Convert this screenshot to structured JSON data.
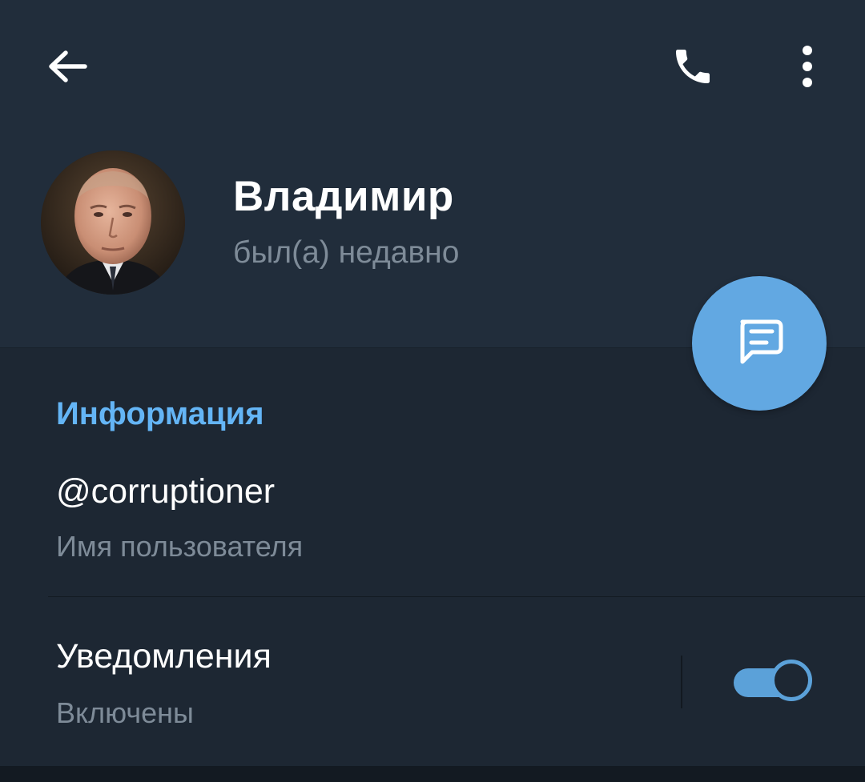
{
  "profile": {
    "name": "Владимир",
    "status": "был(а) недавно"
  },
  "info": {
    "section_title": "Информация",
    "username_value": "@corruptioner",
    "username_label": "Имя пользователя"
  },
  "notifications": {
    "title": "Уведомления",
    "state_label": "Включены",
    "enabled": true
  },
  "icons": {
    "back": "arrow-left-icon",
    "call": "phone-icon",
    "more": "more-vertical-icon",
    "message": "message-icon"
  },
  "colors": {
    "header_bg": "#212d3b",
    "content_bg": "#1d2733",
    "accent": "#62a8e2",
    "section_title": "#64b5f6",
    "secondary_text": "#7e8b98"
  }
}
